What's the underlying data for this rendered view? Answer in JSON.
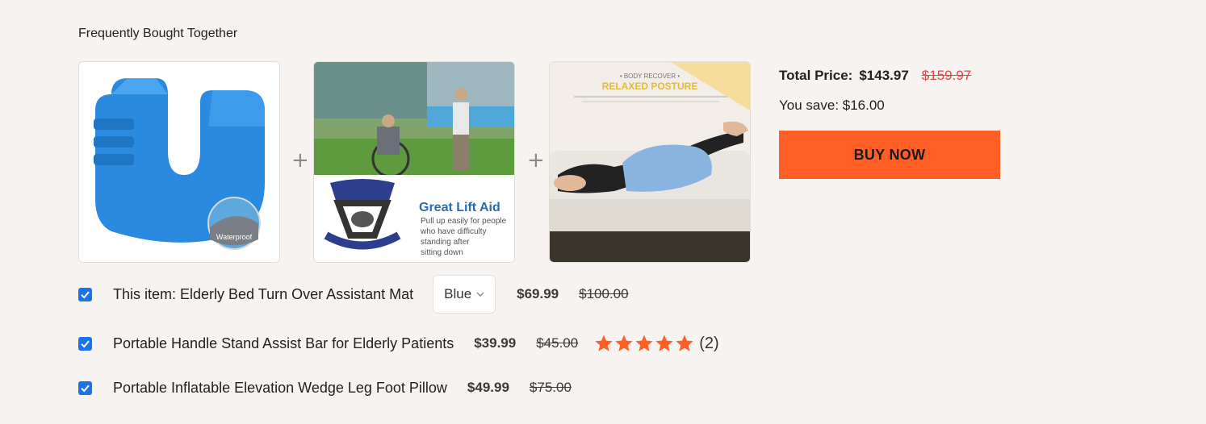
{
  "section_title": "Frequently Bought Together",
  "plus_glyph": "+",
  "images": [
    {
      "icon": "turn-over-mat-image",
      "badge": "Waterproof"
    },
    {
      "icon": "lift-aid-image",
      "headline": "Great Lift Aid",
      "caption_lines": [
        "Pull up easily for people",
        "who have difficulty",
        "standing after",
        "sitting down"
      ]
    },
    {
      "icon": "leg-pillow-image",
      "eyebrow": "• BODY RECOVER •",
      "headline": "RELAXED POSTURE"
    }
  ],
  "summary": {
    "total_label": "Total Price:",
    "total_price": "$143.97",
    "original_total": "$159.97",
    "save_text": "You save: $16.00",
    "buy_label": "BUY NOW"
  },
  "items": [
    {
      "name": "This item: Elderly Bed Turn Over Assistant Mat",
      "variant": "Blue",
      "price": "$69.99",
      "old_price": "$100.00",
      "checked": true
    },
    {
      "name": "Portable Handle Stand Assist Bar for Elderly Patients",
      "price": "$39.99",
      "old_price": "$45.00",
      "rating": 5,
      "reviews": "(2)",
      "checked": true
    },
    {
      "name": "Portable Inflatable Elevation Wedge Leg Foot Pillow",
      "price": "$49.99",
      "old_price": "$75.00",
      "checked": true
    }
  ],
  "colors": {
    "accent": "#ff5f24",
    "checkbox": "#1a73e8",
    "strike_red": "#e04848",
    "star": "#ff5f24"
  }
}
